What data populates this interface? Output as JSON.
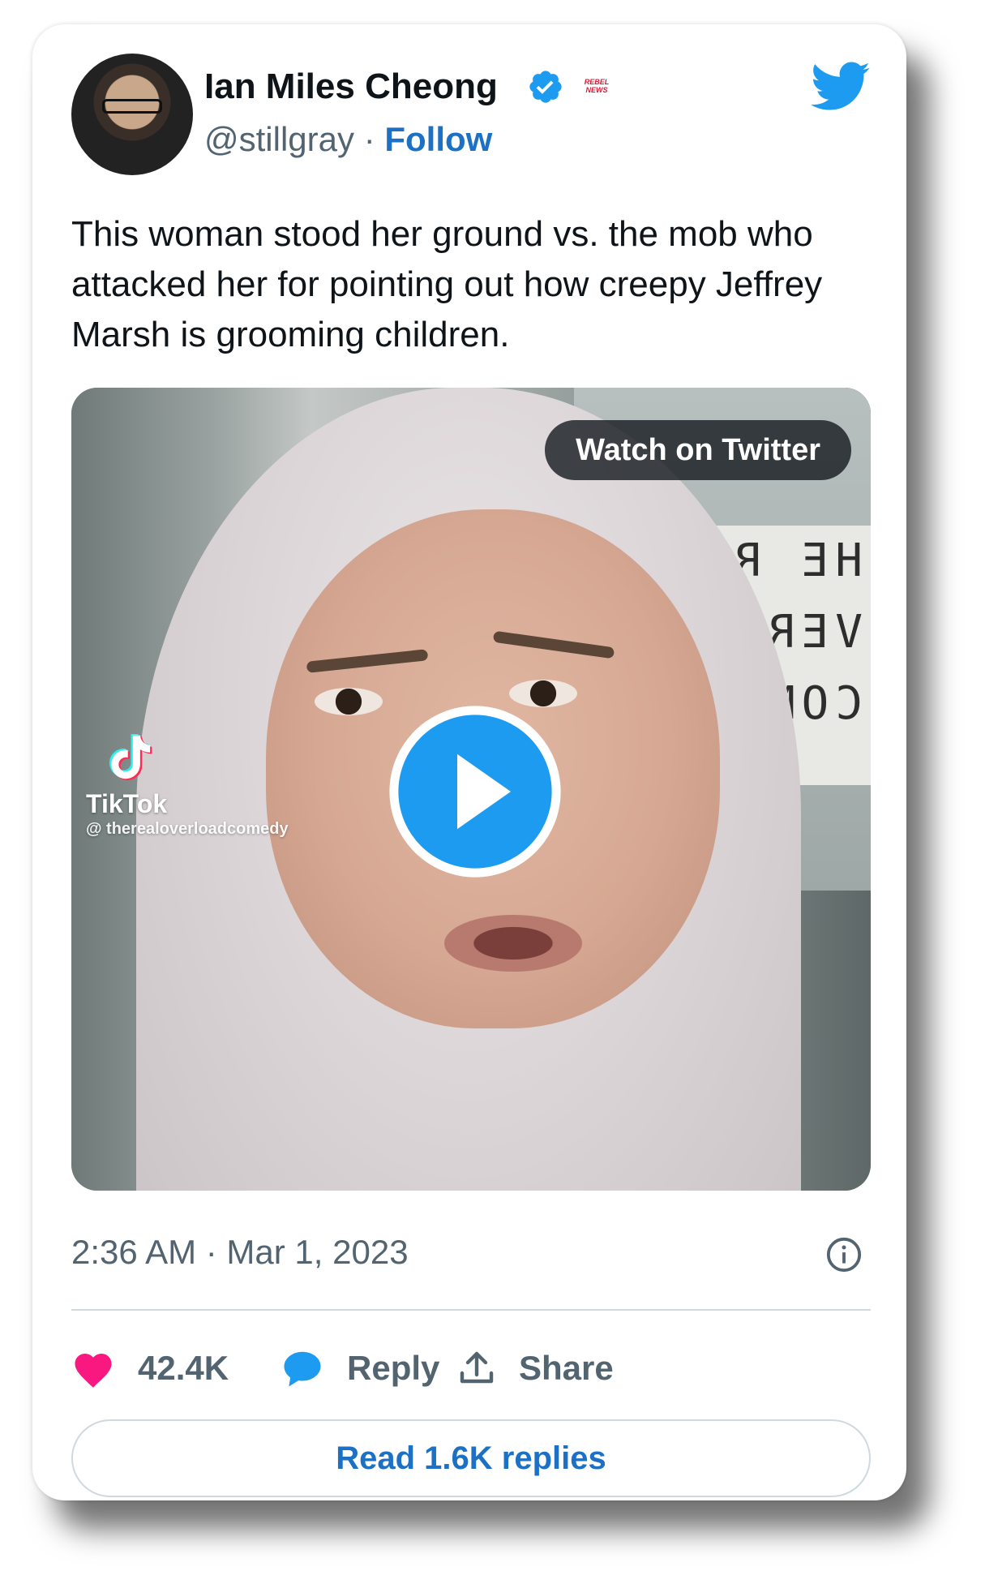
{
  "author": {
    "name": "Ian Miles Cheong",
    "handle": "@stillgray",
    "separator": "·",
    "follow_label": "Follow",
    "affiliate_badge_text": "REBEL NEWS",
    "verified_icon": "verified-badge-icon",
    "avatar_icon": "profile-avatar"
  },
  "brand": {
    "icon": "twitter-bird-icon",
    "color": "#1d9bf0"
  },
  "tweet": {
    "text": "This woman stood her ground vs. the mob who attacked her for pointing out how creepy Jeffrey Marsh is grooming children."
  },
  "media": {
    "watch_label": "Watch on Twitter",
    "tiktok_brand": "TikTok",
    "tiktok_user": "@ therealoverloadcomedy",
    "board_text": "HE REA\nVERLO\nCOME",
    "play_icon": "play-icon"
  },
  "meta": {
    "timestamp": "2:36 AM · Mar 1, 2023",
    "info_icon": "info-icon"
  },
  "actions": {
    "likes_count": "42.4K",
    "reply_label": "Reply",
    "share_label": "Share",
    "like_color": "#f91880",
    "reply_color": "#1d9bf0"
  },
  "replies_button": {
    "label": "Read 1.6K replies"
  },
  "colors": {
    "text_primary": "#0f1419",
    "text_secondary": "#536471",
    "link": "#1d71c4",
    "border": "#cfd9de"
  }
}
